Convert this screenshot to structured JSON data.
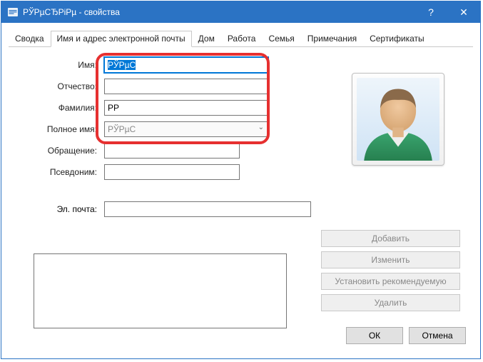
{
  "window": {
    "title": "РЎРµСЂРіРµ           - свойства",
    "help": "?",
    "close": "✕"
  },
  "tabs": [
    {
      "id": "summary",
      "label": "Сводка"
    },
    {
      "id": "name",
      "label": "Имя и адрес электронной почты"
    },
    {
      "id": "home",
      "label": "Дом"
    },
    {
      "id": "work",
      "label": "Работа"
    },
    {
      "id": "family",
      "label": "Семья"
    },
    {
      "id": "notes",
      "label": "Примечания"
    },
    {
      "id": "certs",
      "label": "Сертификаты"
    }
  ],
  "active_tab": "name",
  "form": {
    "name_label": "Имя:",
    "name_value": "РЎРµС",
    "middle_label": "Отчество:",
    "middle_value": "",
    "surname_label": "Фамилия:",
    "surname_value": "РР",
    "fullname_label": "Полное имя:",
    "fullname_value": "РЎРµС",
    "salutation_label": "Обращение:",
    "salutation_value": "",
    "nickname_label": "Псевдоним:",
    "nickname_value": "",
    "email_label": "Эл. почта:",
    "email_value": ""
  },
  "buttons": {
    "add": "Добавить",
    "edit": "Изменить",
    "setdefault": "Установить рекомендуемую",
    "delete": "Удалить",
    "ok": "ОК",
    "cancel": "Отмена"
  }
}
